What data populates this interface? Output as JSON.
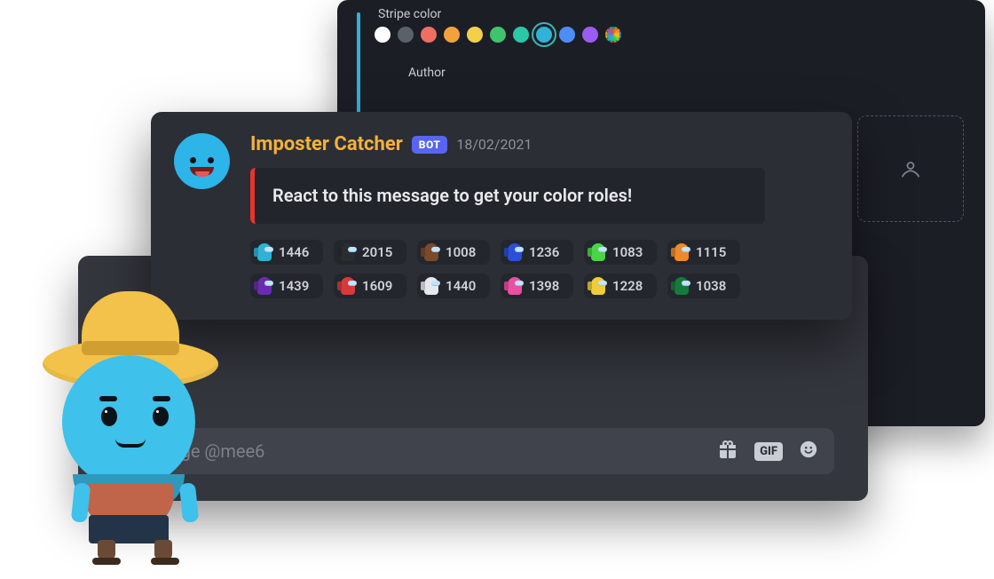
{
  "settings": {
    "stripe_label": "Stripe color",
    "author_label": "Author",
    "swatches": [
      {
        "name": "white",
        "hex": "#ffffff",
        "selected": false
      },
      {
        "name": "slate",
        "hex": "#596169",
        "selected": false
      },
      {
        "name": "red",
        "hex": "#ee6e64",
        "selected": false
      },
      {
        "name": "orange",
        "hex": "#f2a23c",
        "selected": false
      },
      {
        "name": "yellow",
        "hex": "#f3cf4a",
        "selected": false
      },
      {
        "name": "green",
        "hex": "#3fc46b",
        "selected": false
      },
      {
        "name": "teal",
        "hex": "#29c9a7",
        "selected": false
      },
      {
        "name": "cyan",
        "hex": "#2fb2d6",
        "selected": true
      },
      {
        "name": "blue",
        "hex": "#4e8df5",
        "selected": false
      },
      {
        "name": "purple",
        "hex": "#9b5cf0",
        "selected": false
      },
      {
        "name": "rainbow",
        "hex": "rainbow",
        "selected": false
      }
    ]
  },
  "message": {
    "author_name": "Imposter Catcher",
    "bot_tag": "BOT",
    "timestamp": "18/02/2021",
    "embed_stripe": "#e7342c",
    "embed_text": "React to this message to get your color roles!",
    "reactions": [
      {
        "name": "cyan",
        "hex": "#2fb2d6",
        "count": 1446
      },
      {
        "name": "black",
        "hex": "#2b2c30",
        "count": 2015
      },
      {
        "name": "brown",
        "hex": "#7a4a2a",
        "count": 1008
      },
      {
        "name": "blue",
        "hex": "#2b4fd6",
        "count": 1236
      },
      {
        "name": "lime",
        "hex": "#48d646",
        "count": 1083
      },
      {
        "name": "orange",
        "hex": "#ed8a2b",
        "count": 1115
      },
      {
        "name": "purple",
        "hex": "#6a2bb0",
        "count": 1439
      },
      {
        "name": "red",
        "hex": "#d63a3a",
        "count": 1609
      },
      {
        "name": "white",
        "hex": "#e6e8ec",
        "count": 1440
      },
      {
        "name": "pink",
        "hex": "#e94fa2",
        "count": 1398
      },
      {
        "name": "yellow",
        "hex": "#f0cc3a",
        "count": 1228
      },
      {
        "name": "green",
        "hex": "#167a3c",
        "count": 1038
      }
    ]
  },
  "chat": {
    "input_placeholder": "Message @mee6",
    "gif_label": "GIF"
  }
}
